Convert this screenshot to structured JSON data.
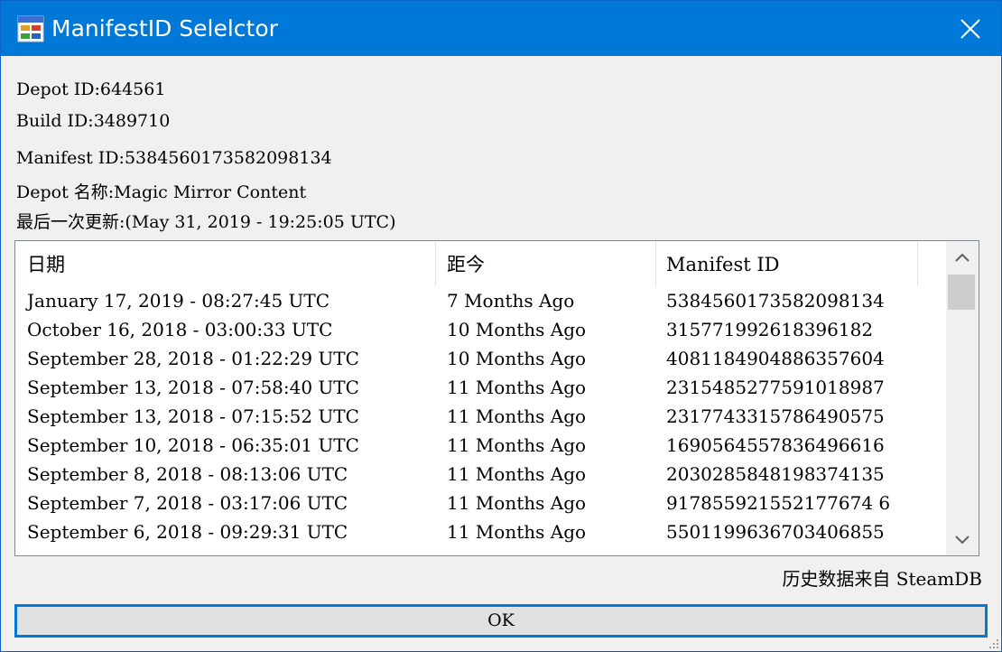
{
  "window": {
    "title": "ManifestID Selelctor",
    "icon": "app-window-icon",
    "close_icon": "close-icon"
  },
  "info": {
    "depot_id": "Depot ID:644561",
    "build_id": "Build ID:3489710",
    "manifest_id": "Manifest ID:5384560173582098134",
    "depot_name": "Depot 名称:Magic Mirror Content",
    "last_update": "最后一次更新:(May 31, 2019 - 19:25:05 UTC)"
  },
  "list": {
    "columns": [
      "日期",
      "距今",
      "Manifest ID"
    ],
    "rows": [
      [
        "January 17, 2019 - 08:27:45 UTC",
        "7 Months Ago",
        "5384560173582098134"
      ],
      [
        "October 16, 2018 - 03:00:33 UTC",
        "10 Months Ago",
        "315771992618396182"
      ],
      [
        "September 28, 2018 - 01:22:29 UTC",
        "10 Months Ago",
        "4081184904886357604"
      ],
      [
        "September 13, 2018 - 07:58:40 UTC",
        "11 Months Ago",
        "2315485277591018987"
      ],
      [
        "September 13, 2018 - 07:15:52 UTC",
        "11 Months Ago",
        "2317743315786490575"
      ],
      [
        "September 10, 2018 - 06:35:01 UTC",
        "11 Months Ago",
        "1690564557836496616"
      ],
      [
        "September 8, 2018 - 08:13:06 UTC",
        "11 Months Ago",
        "2030285848198374135"
      ],
      [
        "September 7, 2018 - 03:17:06 UTC",
        "11 Months Ago",
        "917855921552177674 6"
      ],
      [
        "September 6, 2018 - 09:29:31 UTC",
        "11 Months Ago",
        "5501199636703406855"
      ]
    ]
  },
  "source_note": "历史数据来自 SteamDB",
  "ok_label": "OK",
  "colors": {
    "titlebar": "#0078d7",
    "window_bg": "#f0f0f0",
    "list_bg": "#ffffff",
    "button_bg": "#e1e1e1",
    "button_border": "#0078d7"
  }
}
